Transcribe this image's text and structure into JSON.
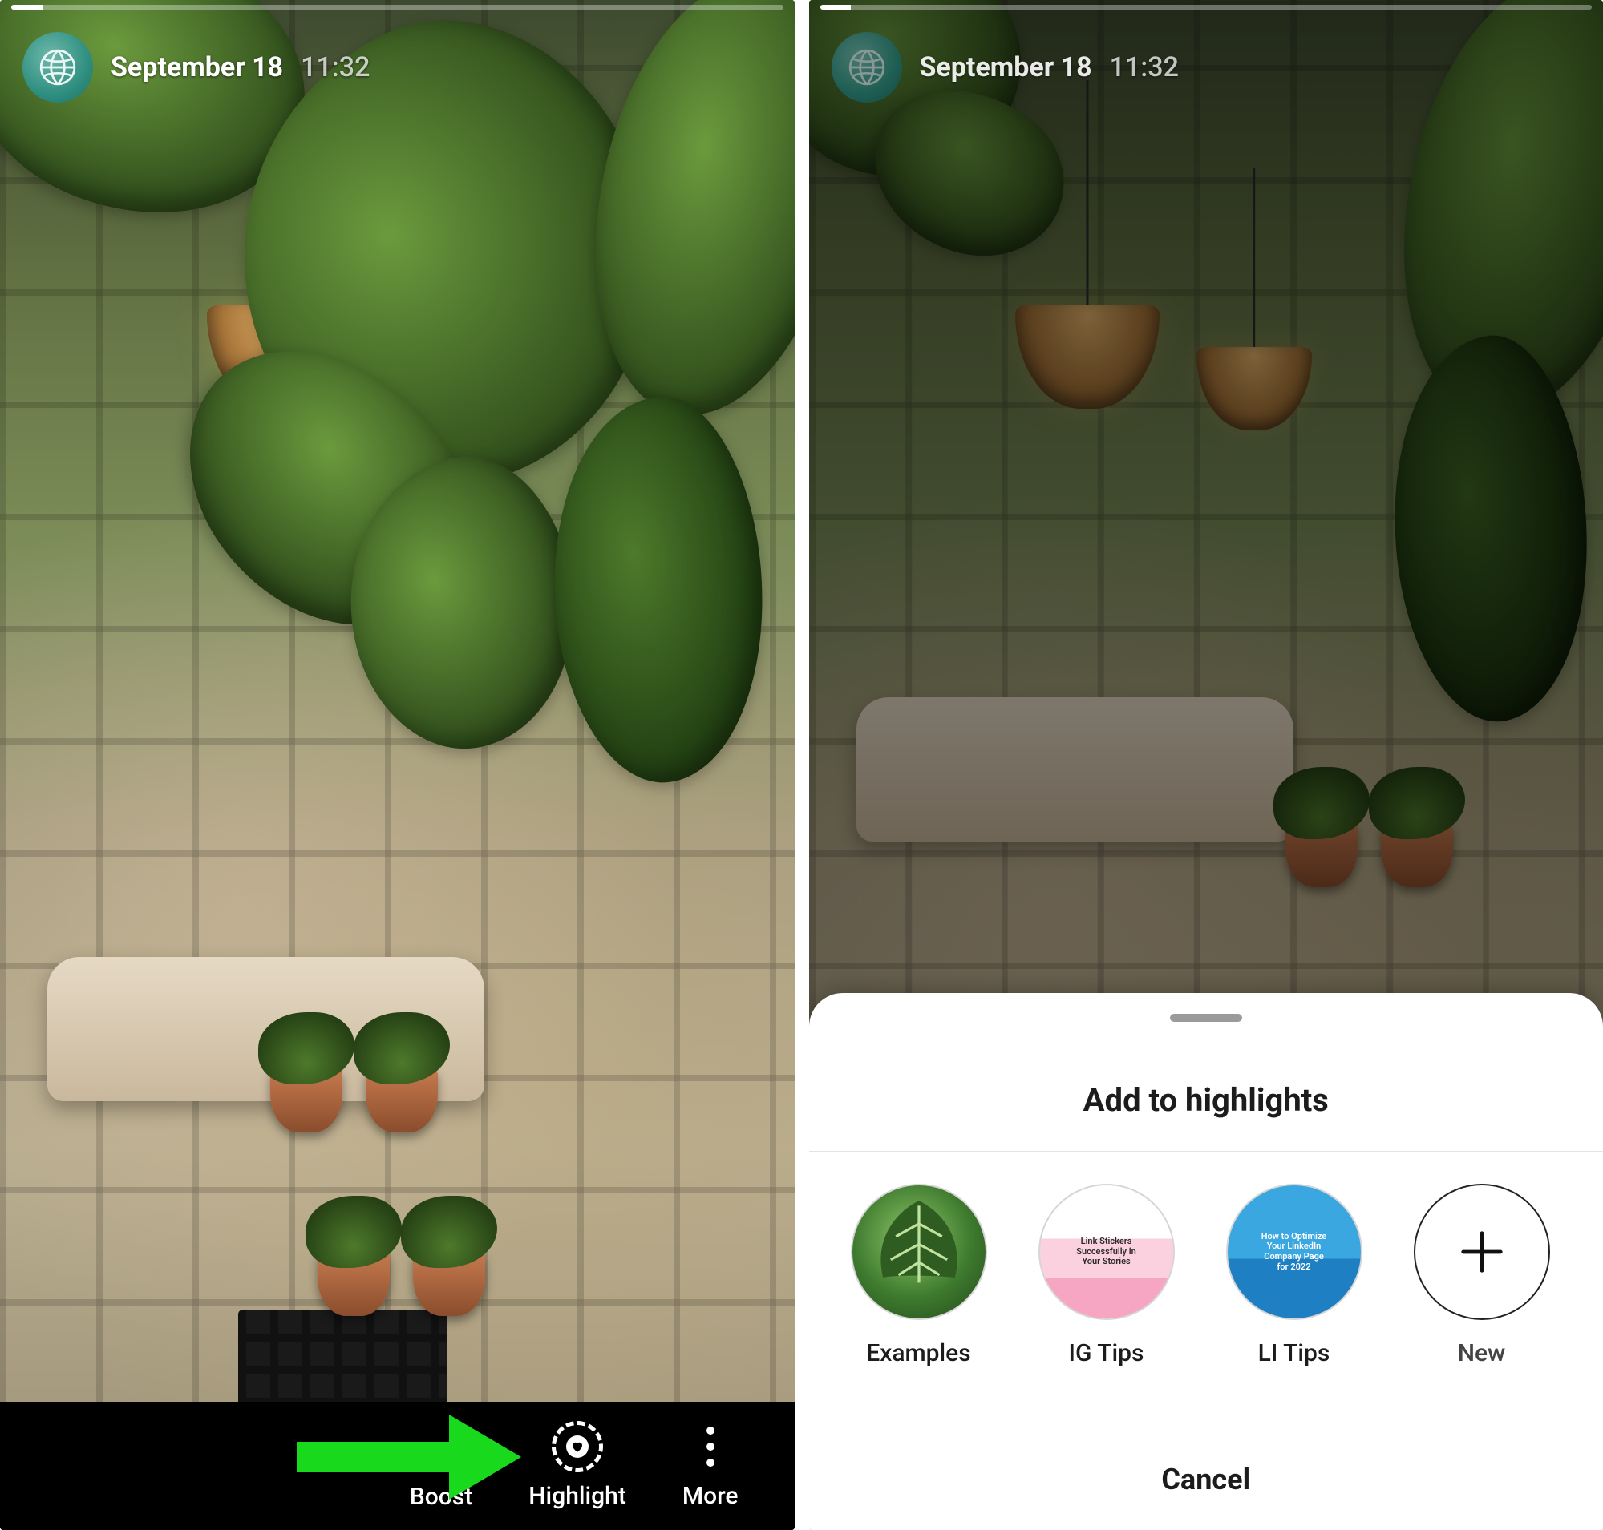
{
  "left": {
    "date": "September 18",
    "time": "11:32",
    "bottom": {
      "boost": "Boost",
      "highlight": "Highlight",
      "more": "More"
    }
  },
  "right": {
    "date": "September 18",
    "time": "11:32",
    "sheet": {
      "title": "Add to highlights",
      "items": [
        {
          "label": "Examples"
        },
        {
          "label": "IG Tips"
        },
        {
          "label": "LI Tips"
        }
      ],
      "new_label": "New",
      "cancel": "Cancel"
    }
  }
}
